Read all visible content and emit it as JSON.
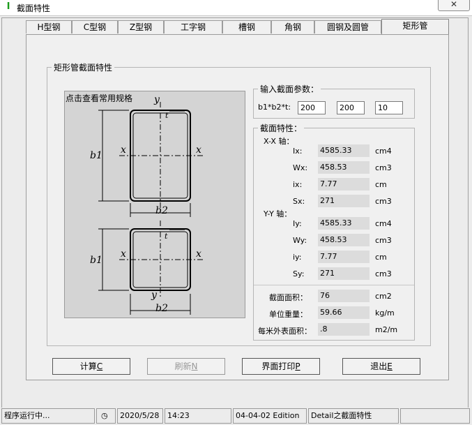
{
  "window": {
    "title": "截面特性",
    "close_label": "✕"
  },
  "tabs": [
    {
      "label": "H型钢"
    },
    {
      "label": "C型钢"
    },
    {
      "label": "Z型钢"
    },
    {
      "label": "工字钢"
    },
    {
      "label": "槽钢"
    },
    {
      "label": "角钢"
    },
    {
      "label": "圆钢及圆管"
    },
    {
      "label": "矩形管",
      "active": true
    }
  ],
  "section_group": {
    "label": "矩形管截面特性"
  },
  "figure": {
    "link": "点击查看常用规格",
    "top": {
      "y_top": "y",
      "t": "t",
      "x_left": "x",
      "x_right": "x",
      "b1": "b1",
      "b2": "b2"
    },
    "bottom": {
      "y_bottom": "y",
      "t": "t",
      "x_left": "x",
      "x_right": "x",
      "b1": "b1",
      "b2": "b2"
    }
  },
  "params": {
    "label": "输入截面参数：",
    "field_label": "b1*b2*t:",
    "b1": "200",
    "b2": "200",
    "t": "10"
  },
  "props": {
    "label": "截面特性：",
    "xx_label": "X-X 轴：",
    "yy_label": "Y-Y 轴：",
    "xx": [
      {
        "name": "Ix:",
        "value": "4585.33",
        "unit": "cm4"
      },
      {
        "name": "Wx:",
        "value": "458.53",
        "unit": "cm3"
      },
      {
        "name": "ix:",
        "value": "7.77",
        "unit": "cm"
      },
      {
        "name": "Sx:",
        "value": "271",
        "unit": "cm3"
      }
    ],
    "yy": [
      {
        "name": "Iy:",
        "value": "4585.33",
        "unit": "cm4"
      },
      {
        "name": "Wy:",
        "value": "458.53",
        "unit": "cm3"
      },
      {
        "name": "iy:",
        "value": "7.77",
        "unit": "cm"
      },
      {
        "name": "Sy:",
        "value": "271",
        "unit": "cm3"
      }
    ],
    "extra": [
      {
        "name": "截面面积：",
        "value": "76",
        "unit": "cm2"
      },
      {
        "name": "单位重量：",
        "value": "59.66",
        "unit": "kg/m"
      },
      {
        "name": "每米外表面积：",
        "value": ".8",
        "unit": "m2/m"
      }
    ]
  },
  "buttons": {
    "calc": {
      "text": "计算",
      "key": "C"
    },
    "refresh": {
      "text": "刷新",
      "key": "N"
    },
    "print": {
      "text": "界面打印",
      "key": "P"
    },
    "exit": {
      "text": "退出",
      "key": "E"
    }
  },
  "status": {
    "state": "程序运行中...",
    "date": "2020/5/28",
    "time": "14:23",
    "edition": "04-04-02 Edition",
    "detail": "Detail之截面特性"
  }
}
